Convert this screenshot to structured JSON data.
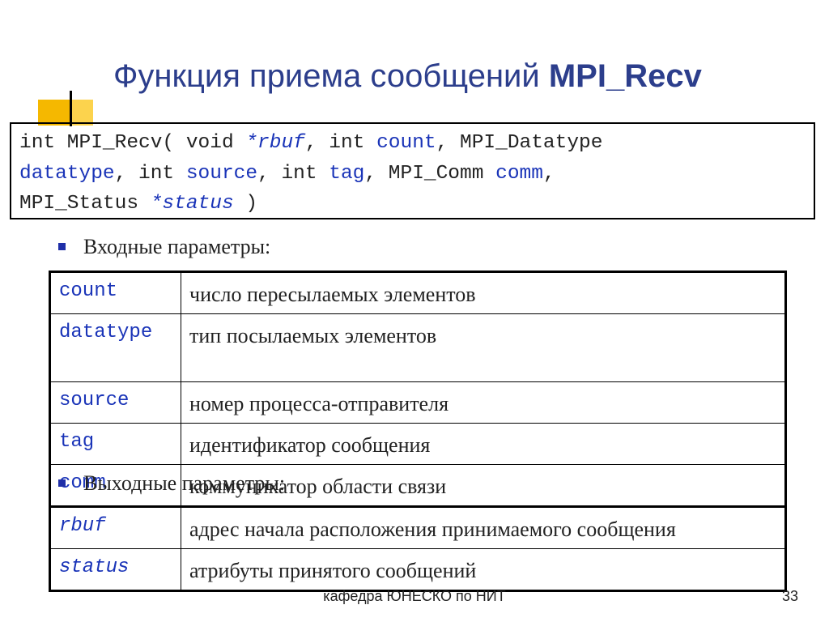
{
  "title": {
    "prefix": "Функция приема сообщений ",
    "bold": "MPI_Recv"
  },
  "signature": {
    "l1_a": "int MPI_Recv( void ",
    "l1_b": "*rbuf",
    "l1_c": ", int ",
    "l1_d": "count",
    "l1_e": ", MPI_Datatype",
    "l2_a": "datatype",
    "l2_b": ", int ",
    "l2_c": "source",
    "l2_d": ", int ",
    "l2_e": "tag",
    "l2_f": ", MPI_Comm ",
    "l2_g": "comm",
    "l2_h": ",",
    "l3_a": "MPI_Status ",
    "l3_b": "*status",
    "l3_c": " )"
  },
  "input_heading": "Входные параметры:",
  "input_params": [
    {
      "name": "count",
      "desc": "число пересылаемых элементов"
    },
    {
      "name": "datatype",
      "desc": "тип посылаемых элементов"
    },
    {
      "name": "source",
      "desc": "номер процесса-отправителя"
    },
    {
      "name": "tag",
      "desc": "идентификатор сообщения"
    },
    {
      "name": "comm",
      "desc": "коммуникатор области связи"
    }
  ],
  "output_heading": "Выходные параметры:",
  "output_params": [
    {
      "name": "rbuf",
      "desc": "адрес начала расположения принимаемого сообщения"
    },
    {
      "name": "status",
      "desc": "атрибуты принятого сообщений"
    }
  ],
  "footer": "кафедра ЮНЕСКО по НИТ",
  "page_number": "33"
}
